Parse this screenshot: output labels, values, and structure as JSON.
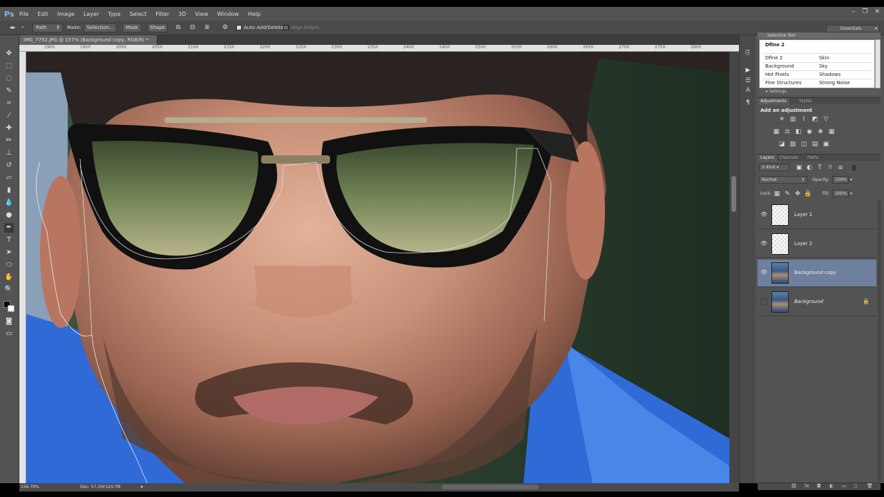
{
  "app": {
    "logo": "Ps"
  },
  "menu": [
    "File",
    "Edit",
    "Image",
    "Layer",
    "Type",
    "Select",
    "Filter",
    "3D",
    "View",
    "Window",
    "Help"
  ],
  "window_controls": [
    "–",
    "❐",
    "✕"
  ],
  "options": {
    "mode": "Path",
    "make_label": "Make:",
    "selection_btn": "Selection...",
    "mask_btn": "Mask",
    "shape_btn": "Shape",
    "auto_add_delete": "Auto Add/Delete",
    "align_edges": "Align Edges"
  },
  "workspace": "Essentials",
  "document": {
    "tab": "IMG_7792.JPG @ 157% (Background copy, RGB/8) *",
    "close": "×"
  },
  "ruler_ticks": [
    "1900",
    "1950",
    "2000",
    "2050",
    "2100",
    "2150",
    "2200",
    "2250",
    "2300",
    "2350",
    "2400",
    "2450",
    "2500",
    "2550",
    "2600",
    "2650",
    "2700",
    "2750",
    "2800"
  ],
  "status": {
    "zoom": "156.79%",
    "doc": "Doc: 57.1M/124.7M"
  },
  "selective_tool": {
    "panel_label": "Selective Tool",
    "title": "Dfine 2",
    "rows": [
      [
        "Dfine 2",
        "Skin"
      ],
      [
        "Background",
        "Sky"
      ],
      [
        "Hot Pixels",
        "Shadows"
      ],
      [
        "Fine Structures",
        "Strong Noise"
      ]
    ],
    "settings": "Settings"
  },
  "adjustments": {
    "tabs": [
      "Adjustments",
      "Styles"
    ],
    "heading": "Add an adjustment"
  },
  "layers_panel": {
    "tabs": [
      "Layers",
      "Channels",
      "Paths"
    ],
    "kind": "Kind",
    "blend_mode": "Normal",
    "opacity_label": "Opacity:",
    "opacity": "100%",
    "lock_label": "Lock:",
    "fill_label": "Fill:",
    "fill": "100%",
    "layers": [
      {
        "name": "Layer 1",
        "visible": true,
        "selected": false
      },
      {
        "name": "Layer 2",
        "visible": true,
        "selected": false
      },
      {
        "name": "Background copy",
        "visible": true,
        "selected": true
      },
      {
        "name": "Background",
        "visible": false,
        "selected": false,
        "locked": true
      }
    ]
  },
  "colors": {
    "accent_selected": "#6f7f9e",
    "ui_bg": "#535353"
  }
}
